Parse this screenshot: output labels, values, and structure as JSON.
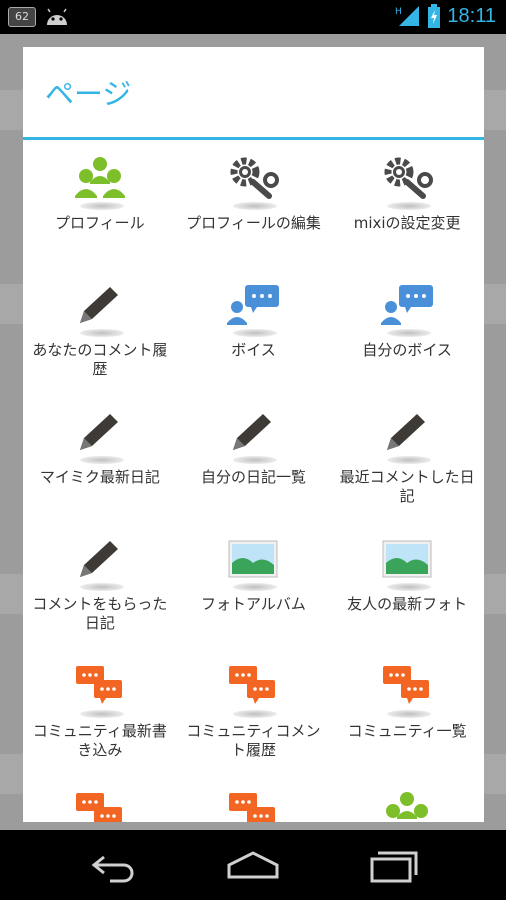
{
  "status_bar": {
    "notification_count": "62",
    "time": "18:11",
    "icons": [
      "notification-icon",
      "android-icon",
      "signal-icon",
      "battery-icon"
    ]
  },
  "dialog": {
    "title": "ページ",
    "items": [
      {
        "label": "プロフィール",
        "icon": "profile-group-icon"
      },
      {
        "label": "プロフィールの編集",
        "icon": "settings-icon"
      },
      {
        "label": "mixiの設定変更",
        "icon": "settings-icon"
      },
      {
        "label": "あなたのコメント履歴",
        "icon": "pencil-icon"
      },
      {
        "label": "ボイス",
        "icon": "voice-icon"
      },
      {
        "label": "自分のボイス",
        "icon": "voice-icon"
      },
      {
        "label": "マイミク最新日記",
        "icon": "pencil-icon"
      },
      {
        "label": "自分の日記一覧",
        "icon": "pencil-icon"
      },
      {
        "label": "最近コメントした日記",
        "icon": "pencil-icon"
      },
      {
        "label": "コメントをもらった日記",
        "icon": "pencil-icon"
      },
      {
        "label": "フォトアルバム",
        "icon": "photo-icon"
      },
      {
        "label": "友人の最新フォト",
        "icon": "photo-icon"
      },
      {
        "label": "コミュニティ最新書き込み",
        "icon": "community-icon"
      },
      {
        "label": "コミュニティコメント履歴",
        "icon": "community-icon"
      },
      {
        "label": "コミュニティ一覧",
        "icon": "community-icon"
      },
      {
        "label": "",
        "icon": "community-icon"
      },
      {
        "label": "",
        "icon": "community-icon"
      },
      {
        "label": "",
        "icon": "profile-group-icon"
      }
    ]
  },
  "colors": {
    "accent": "#33b5e5",
    "profile_green": "#7cbf2a",
    "community_orange": "#f26522",
    "voice_blue": "#4a90d9"
  },
  "nav_bar": {
    "buttons": [
      "back-icon",
      "home-icon",
      "recent-apps-icon"
    ]
  }
}
